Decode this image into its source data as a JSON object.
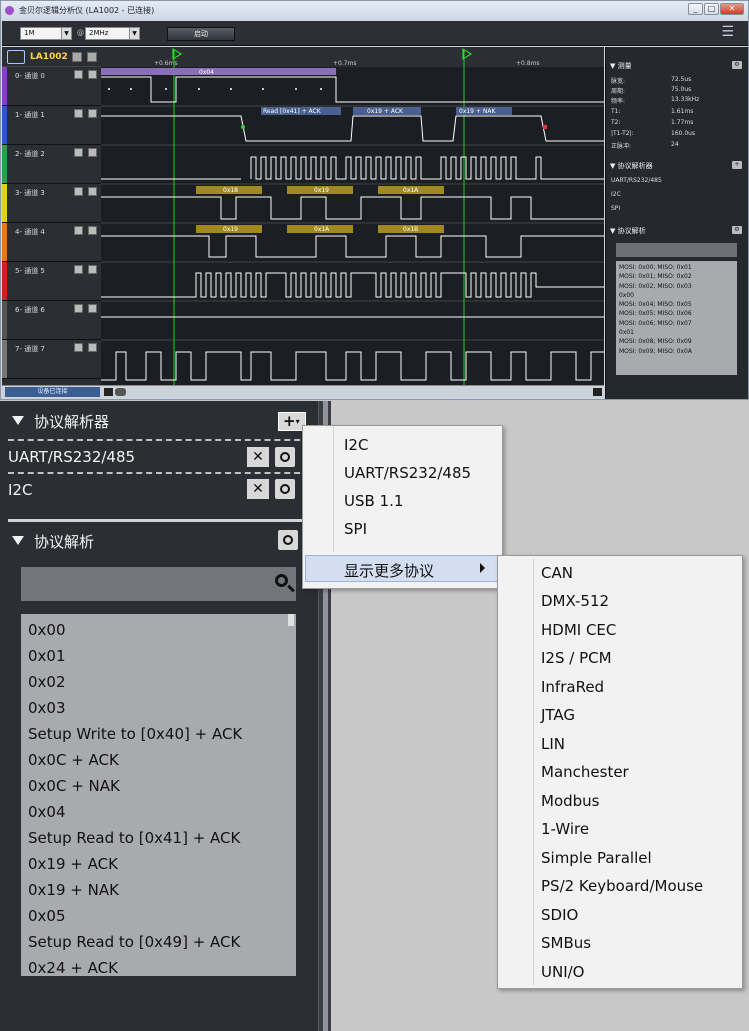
{
  "window": {
    "title": "金贝尔逻辑分析仪 (LA1002 - 已连接)",
    "min": "_",
    "max": "□",
    "close": "✕"
  },
  "toolbar": {
    "sample_depth": "1M",
    "rate_prefix": "@",
    "sample_rate": "2MHz",
    "start_label": "启动"
  },
  "device": {
    "name": "LA1002",
    "status": "设备已连接"
  },
  "channels": [
    {
      "label": "0- 通道 0",
      "color": "#8a3ec0"
    },
    {
      "label": "1- 通道 1",
      "color": "#2e58c8"
    },
    {
      "label": "2- 通道 2",
      "color": "#2aa04a"
    },
    {
      "label": "3- 通道 3",
      "color": "#e0d020"
    },
    {
      "label": "4- 通道 4",
      "color": "#e07a20"
    },
    {
      "label": "5- 通道 5",
      "color": "#d02020"
    },
    {
      "label": "6- 通道 6",
      "color": "#555555"
    },
    {
      "label": "7- 通道 7",
      "color": "#777777"
    }
  ],
  "timeline": {
    "t1": "+0.6ms",
    "t2": "+0.7ms",
    "t3": "+0.8ms"
  },
  "decode_labels": {
    "ch0": "0x04",
    "ch1": [
      "Read [0x41] + ACK",
      "0x19 + ACK",
      "0x19 + NAK"
    ],
    "ch3": [
      "0x18",
      "0x19",
      "0x1A"
    ],
    "ch4": [
      "0x19",
      "0x1A",
      "0x1B"
    ]
  },
  "measure": {
    "title": "测量",
    "rows": [
      {
        "k": "脉宽:",
        "v": "72.5us"
      },
      {
        "k": "周期:",
        "v": "75.0us"
      },
      {
        "k": "频率:",
        "v": "13.33kHz"
      },
      {
        "k": "T1:",
        "v": "1.61ms"
      },
      {
        "k": "T2:",
        "v": "1.77ms"
      },
      {
        "k": "|T1-T2|:",
        "v": "160.0us"
      },
      {
        "k": "正脉冲:",
        "v": "24"
      }
    ]
  },
  "right_analyzers": {
    "title": "协议解析器",
    "items": [
      "UART/RS232/485",
      "I2C",
      "SPI"
    ]
  },
  "right_decode": {
    "title": "协议解析",
    "items": [
      "MOSI: 0x00;  MISO: 0x01",
      "MOSI: 0x01;  MISO: 0x02",
      "MOSI: 0x02;  MISO: 0x03",
      "0x00",
      "MOSI: 0x04;  MISO: 0x05",
      "MOSI: 0x05;  MISO: 0x06",
      "MOSI: 0x06;  MISO: 0x07",
      "0x01",
      "MOSI: 0x08;  MISO: 0x09",
      "MOSI: 0x09;  MISO: 0x0A"
    ]
  },
  "analyzers": {
    "title": "协议解析器",
    "add": "+",
    "items": [
      "UART/RS232/485",
      "I2C"
    ],
    "remove": "✕"
  },
  "decode": {
    "title": "协议解析",
    "items": [
      "0x00",
      "0x01",
      "0x02",
      "0x03",
      "Setup Write to [0x40] + ACK",
      "0x0C + ACK",
      "0x0C + NAK",
      "0x04",
      "Setup Read to [0x41] + ACK",
      "0x19 + ACK",
      "0x19 + NAK",
      "0x05",
      "Setup Read to [0x49] + ACK",
      "0x24 + ACK"
    ]
  },
  "add_menu": {
    "items": [
      "I2C",
      "UART/RS232/485",
      "USB 1.1",
      "SPI"
    ],
    "more": "显示更多协议"
  },
  "more_menu": {
    "items": [
      "CAN",
      "DMX-512",
      "HDMI CEC",
      "I2S / PCM",
      "InfraRed",
      "JTAG",
      "LIN",
      "Manchester",
      "Modbus",
      "1-Wire",
      "Simple Parallel",
      "PS/2 Keyboard/Mouse",
      "SDIO",
      "SMBus",
      "UNI/O"
    ]
  }
}
